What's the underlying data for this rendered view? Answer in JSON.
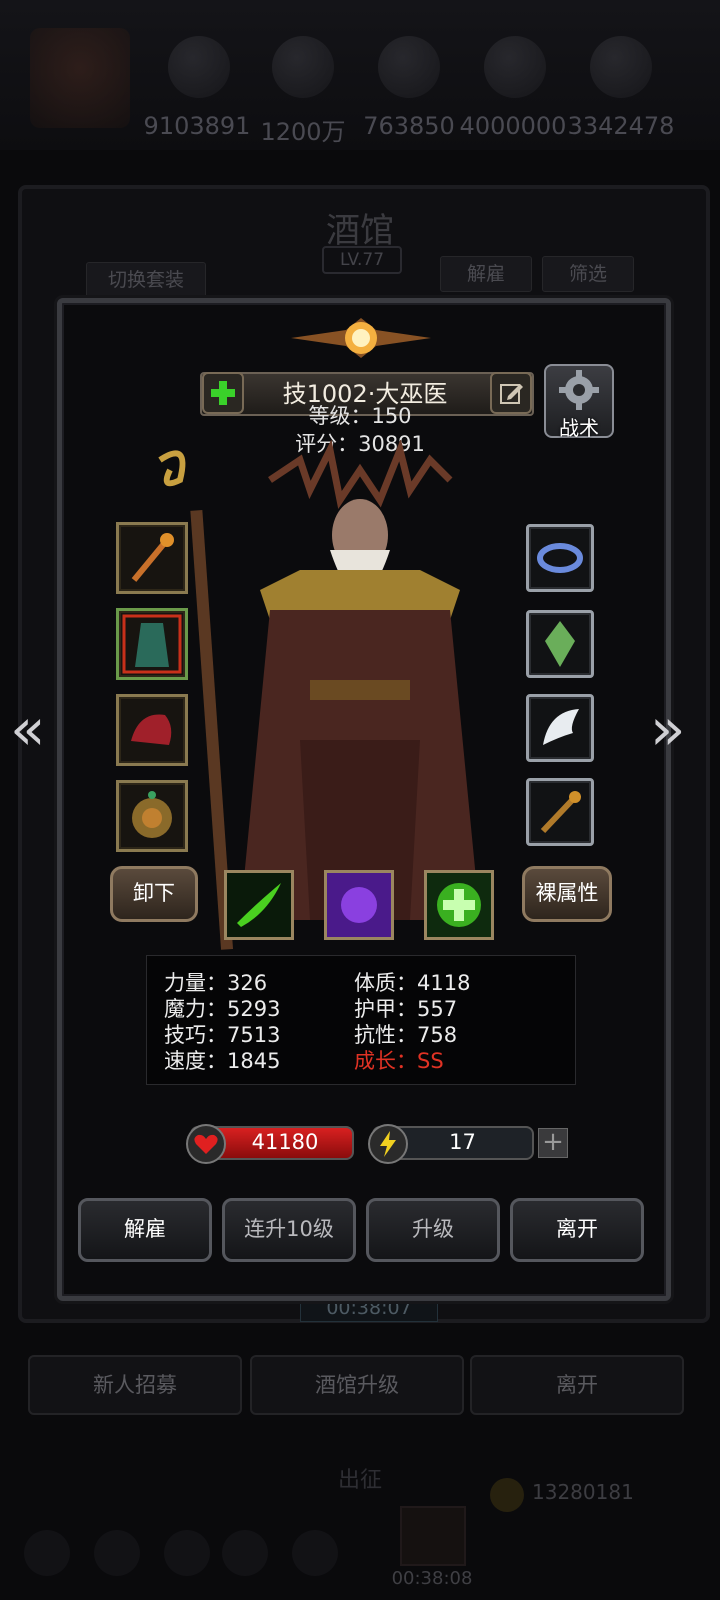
{
  "background": {
    "resources": [
      "9103891",
      "1200万",
      "763850",
      "4000000",
      "3342478"
    ],
    "title": "酒馆",
    "level": "LV.77",
    "switch_outfit": "切换套装",
    "dismiss": "解雇",
    "filter": "筛选",
    "timer": "00:38:07",
    "actions": [
      "新人招募",
      "酒馆升级",
      "离开"
    ],
    "expedition": "出征",
    "bottom_value": "13280181",
    "bottom_timer": "00:38:08"
  },
  "hero": {
    "name": "技1002·大巫医",
    "level_line": "等级：150",
    "score_line": "评分：30891",
    "tactic_label": "战术",
    "unequip_label": "卸下",
    "naked_attr_label": "裸属性"
  },
  "stats": {
    "strength": "力量：326",
    "magic": "魔力：5293",
    "skill": "技巧：7513",
    "speed": "速度：1845",
    "constitution": "体质：4118",
    "armor": "护甲：557",
    "resistance": "抗性：758",
    "growth": "成长：SS"
  },
  "bars": {
    "hp": "41180",
    "energy": "17",
    "energy_fill_fraction": 0.13
  },
  "dialog_actions": {
    "dismiss": "解雇",
    "level_up_10": "连升10级",
    "level_up": "升级",
    "leave": "离开"
  },
  "colors": {
    "growth_red": "#e03224",
    "hp_red": "#d82020",
    "energy_yellow": "#f0dc40"
  }
}
